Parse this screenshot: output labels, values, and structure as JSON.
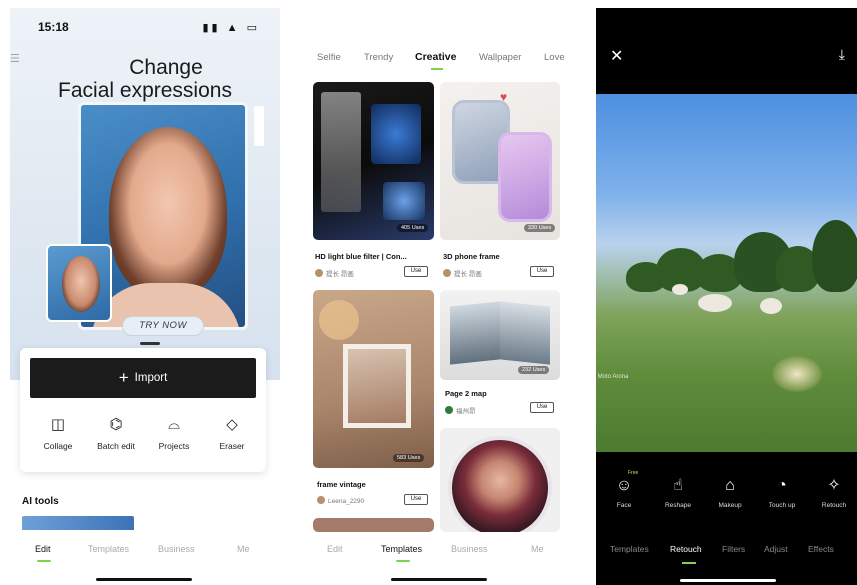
{
  "phone1": {
    "status_time": "15:18",
    "status_icons": "▮▮ ▲ ▭",
    "hero_title_line1": "Change",
    "hero_title_line2": "Facial expressions",
    "try_now": "TRY NOW",
    "import_label": "Import",
    "tools": [
      {
        "label": "Collage",
        "icon": "collage-icon"
      },
      {
        "label": "Batch edit",
        "icon": "batch-edit-icon"
      },
      {
        "label": "Projects",
        "icon": "projects-icon"
      },
      {
        "label": "Eraser",
        "icon": "eraser-icon"
      }
    ],
    "ai_tools_label": "AI tools",
    "tabs": [
      "Edit",
      "Templates",
      "Business",
      "Me"
    ]
  },
  "phone2": {
    "categories": [
      "Selfie",
      "Trendy",
      "Creative",
      "Wallpaper",
      "Love"
    ],
    "active_category": "Creative",
    "tiles": [
      {
        "title": "HD light blue filter | Con...",
        "user": "提长 昂画",
        "uses": "405 Uses",
        "button": "Use"
      },
      {
        "title": "3D phone frame",
        "user": "提长 昂画",
        "uses": "330 Uses",
        "button": "Use"
      },
      {
        "title": "Page 2 map",
        "user": "福州昂",
        "uses": "232 Uses",
        "button": "Use"
      },
      {
        "title": "frame vintage",
        "user": "Leena_2290",
        "uses": "583 Uses",
        "button": "Use"
      }
    ],
    "tabs": [
      "Edit",
      "Templates",
      "Business",
      "Me"
    ]
  },
  "phone3": {
    "watermark": "Moto Arona",
    "tools": [
      {
        "label": "Face",
        "icon": "face-icon",
        "badge": "Free"
      },
      {
        "label": "Reshape",
        "icon": "reshape-icon"
      },
      {
        "label": "Makeup",
        "icon": "makeup-icon"
      },
      {
        "label": "Touch up",
        "icon": "touch-up-icon"
      },
      {
        "label": "Retouch",
        "icon": "retouch-icon"
      }
    ],
    "tabs": [
      "Templates",
      "Retouch",
      "Filters",
      "Adjust",
      "Effects"
    ]
  }
}
